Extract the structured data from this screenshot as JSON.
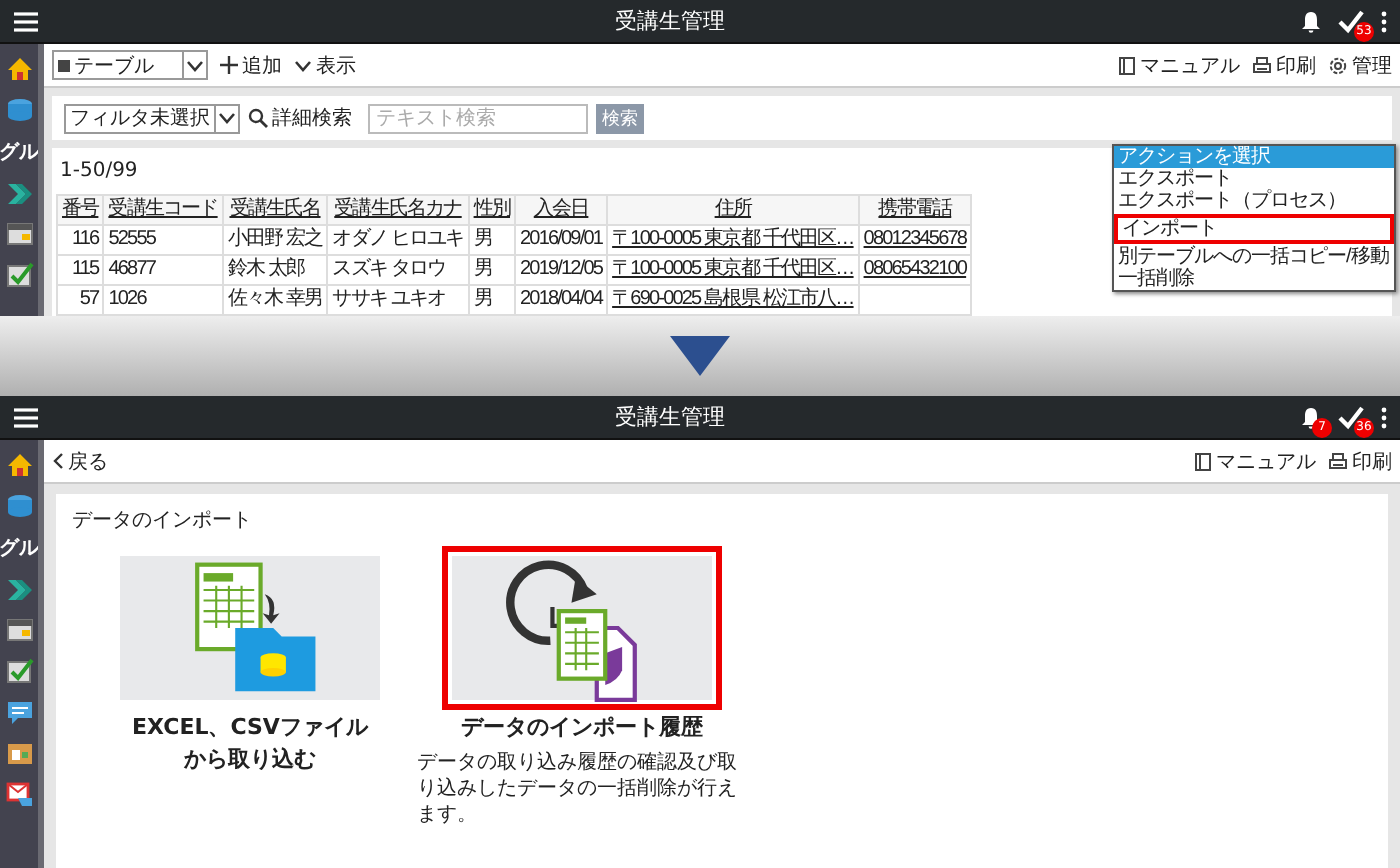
{
  "before": {
    "header": {
      "title": "受講生管理",
      "task_badge": "53"
    },
    "sidebar_label": "グル",
    "toolbar": {
      "view": "テーブル",
      "add": "追加",
      "display": "表示",
      "links": [
        {
          "kind": "book",
          "label": "マニュアル"
        },
        {
          "kind": "printer",
          "label": "印刷"
        },
        {
          "kind": "gear",
          "label": "管理"
        }
      ]
    },
    "filter": {
      "select": "フィルタ未選択",
      "detail": "詳細検索",
      "placeholder": "テキスト検索",
      "button": "検索"
    },
    "count": "1-50/99",
    "table": {
      "columns": [
        "番号",
        "受講生コード",
        "受講生氏名",
        "受講生氏名カナ",
        "性別",
        "入会日",
        "住所",
        "携帯電話"
      ],
      "rows": [
        {
          "cells": [
            "116",
            "52555",
            "小田野 宏之",
            "オダノ ヒロユキ",
            "男",
            "2016/09/01",
            "〒100-0005 東京都 千代田区…",
            "08012345678"
          ]
        },
        {
          "cells": [
            "115",
            "46877",
            "鈴木 太郎",
            "スズキ タロウ",
            "男",
            "2019/12/05",
            "〒100-0005 東京都 千代田区…",
            "08065432100"
          ]
        },
        {
          "cells": [
            "57",
            "1026",
            "佐々木 幸男",
            "ササキ ユキオ",
            "男",
            "2018/04/04",
            "〒690-0025 島根県 松江市八…"
          ]
        }
      ]
    },
    "action_menu": [
      {
        "label": "アクションを選択",
        "selected": true,
        "marked": false
      },
      {
        "label": "エクスポート",
        "selected": false,
        "marked": false
      },
      {
        "label": "エクスポート（プロセス）",
        "selected": false,
        "marked": false
      },
      {
        "label": "インポート",
        "selected": false,
        "marked": true
      },
      {
        "label": "別テーブルへの一括コピー/移動",
        "selected": false,
        "marked": false
      },
      {
        "label": "一括削除",
        "selected": false,
        "marked": false
      }
    ]
  },
  "after": {
    "header": {
      "title": "受講生管理",
      "bell_badge": "7",
      "task_badge": "36"
    },
    "sidebar_label": "グル",
    "back": "戻る",
    "links": [
      {
        "kind": "book",
        "label": "マニュアル"
      },
      {
        "kind": "printer",
        "label": "印刷"
      }
    ],
    "section_title": "データのインポート",
    "cards": [
      {
        "kind": "excel",
        "title_lines": [
          "EXCEL、CSVファイル",
          "から取り込む"
        ],
        "marked": false
      },
      {
        "kind": "history",
        "title_lines": [
          "データのインポート履歴"
        ],
        "description": "データの取り込み履歴の確認及び取り込みしたデータの一括削除が行えます。",
        "marked": true
      }
    ]
  }
}
